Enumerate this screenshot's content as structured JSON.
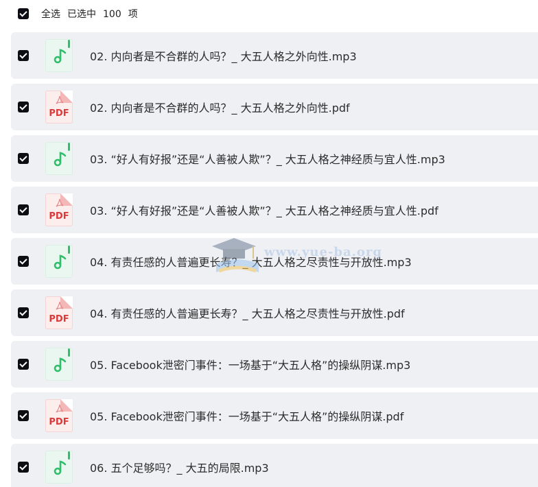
{
  "header": {
    "select_all_label": "全选",
    "selected_prefix": "已选中",
    "selected_count": "100",
    "selected_suffix": "项"
  },
  "files": [
    {
      "name": "02. 内向者是不合群的人吗？_ 大五人格之外向性.mp3",
      "type": "mp3"
    },
    {
      "name": "02. 内向者是不合群的人吗？_ 大五人格之外向性.pdf",
      "type": "pdf"
    },
    {
      "name": "03. “好人有好报”还是“人善被人欺”？_ 大五人格之神经质与宜人性.mp3",
      "type": "mp3"
    },
    {
      "name": "03. “好人有好报”还是“人善被人欺”？_ 大五人格之神经质与宜人性.pdf",
      "type": "pdf"
    },
    {
      "name": "04. 有责任感的人普遍更长寿？_ 大五人格之尽责性与开放性.mp3",
      "type": "mp3"
    },
    {
      "name": "04. 有责任感的人普遍更长寿？_ 大五人格之尽责性与开放性.pdf",
      "type": "pdf"
    },
    {
      "name": "05. Facebook泄密门事件：一场基于“大五人格”的操纵阴谋.mp3",
      "type": "mp3"
    },
    {
      "name": "05. Facebook泄密门事件：一场基于“大五人格”的操纵阴谋.pdf",
      "type": "pdf"
    },
    {
      "name": "06. 五个足够吗？_ 大五的局限.mp3",
      "type": "mp3"
    }
  ],
  "icons": {
    "pdf_label": "PDF",
    "mp3_icon": "music-note-icon",
    "pdf_icon": "pdf-file-icon",
    "checkbox_icon": "checkmark-icon"
  },
  "watermark_text": "www.yue-ba.org",
  "colors": {
    "checkbox": "#0d0e14",
    "row_background": "#eff0f3",
    "mp3_accent": "#2fbf6b",
    "pdf_accent": "#d93a3a"
  }
}
